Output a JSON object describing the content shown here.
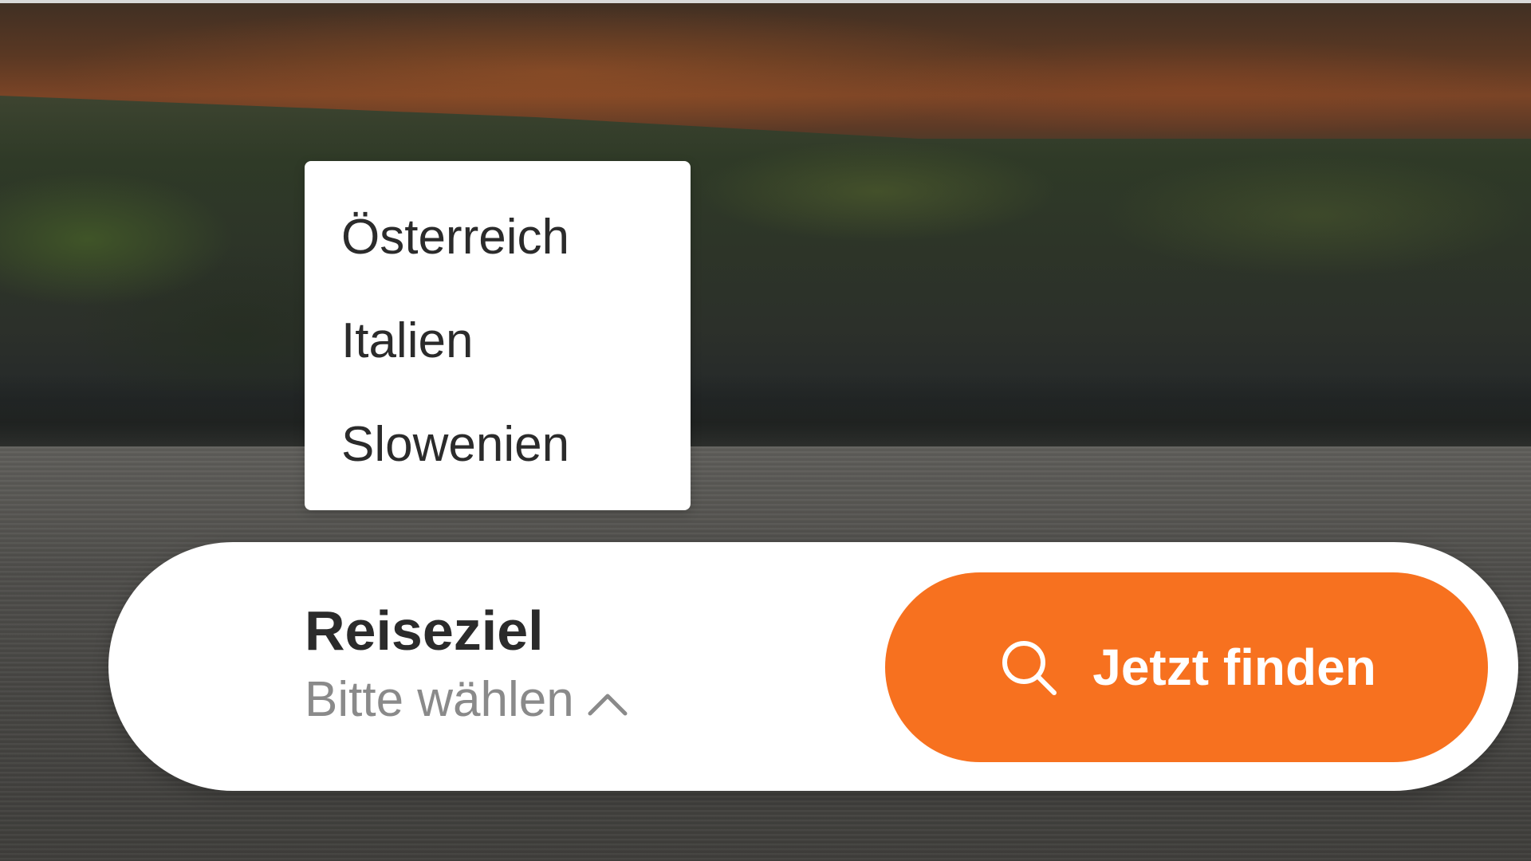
{
  "dropdown": {
    "options": [
      {
        "label": "Österreich"
      },
      {
        "label": "Italien"
      },
      {
        "label": "Slowenien"
      }
    ]
  },
  "search": {
    "destination_label": "Reiseziel",
    "destination_value": "Bitte wählen",
    "submit_label": "Jetzt finden"
  },
  "icons": {
    "dropdown_toggle": "chevron-up-icon",
    "submit": "search-icon"
  },
  "colors": {
    "accent": "#f7711f",
    "label_text": "#2b2b2b",
    "placeholder_text": "#8a8a8a",
    "surface": "#ffffff"
  }
}
